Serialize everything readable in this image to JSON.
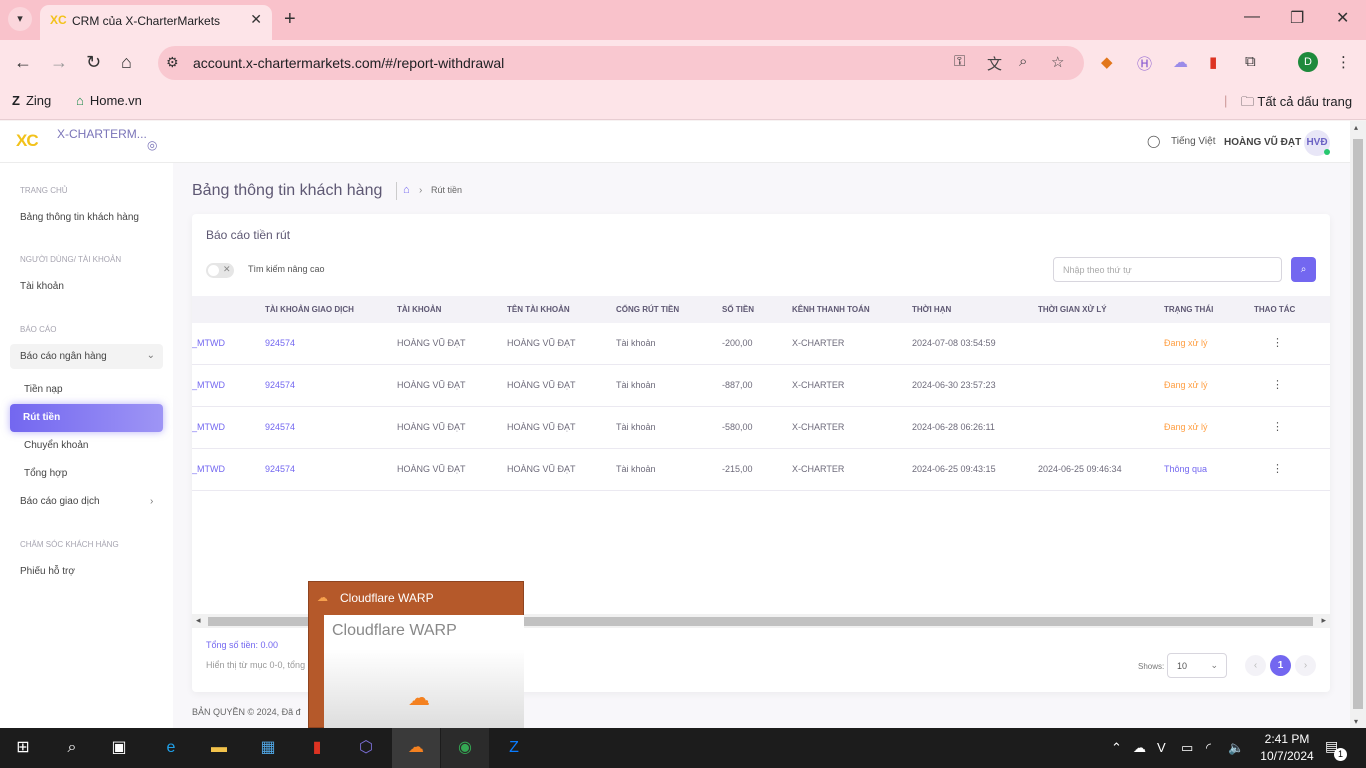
{
  "browser": {
    "tab_title": "CRM của X-CharterMarkets",
    "tab_logo": "XC",
    "url": "account.x-chartermarkets.com/#/report-withdrawal",
    "profile_letter": "D",
    "bookmarks": [
      {
        "label": "Zing",
        "icon": "Z"
      },
      {
        "label": "Home.vn",
        "icon": "⌂"
      }
    ],
    "all_bookmarks": "Tất cả dấu trang"
  },
  "header": {
    "logo_mark": "XC",
    "logo_text": "X-CHARTERM...",
    "language": "Tiếng Việt",
    "user_name": "HOÀNG VŨ ĐẠT",
    "avatar_initials": "HVĐ"
  },
  "sidebar": {
    "sec_home": "TRANG CHỦ",
    "dashboard": "Bảng thông tin khách hàng",
    "sec_users": "NGƯỜI DÙNG/ TÀI KHOẢN",
    "accounts": "Tài khoản",
    "sec_reports": "BÁO CÁO",
    "bank_reports": "Báo cáo ngân hàng",
    "deposit": "Tiền nạp",
    "withdraw": "Rút tiền",
    "transfer": "Chuyển khoản",
    "summary": "Tổng hợp",
    "trade_reports": "Báo cáo giao dịch",
    "sec_support": "CHĂM SÓC KHÁCH HÀNG",
    "tickets": "Phiếu hỗ trợ"
  },
  "page": {
    "title": "Bảng thông tin khách hàng",
    "breadcrumb_current": "Rút tiền",
    "card_title": "Báo cáo tiền rút",
    "advanced_search": "Tìm kiếm nâng cao",
    "search_placeholder": "Nhập theo thứ tự"
  },
  "table": {
    "headers": [
      "TÀI KHOẢN GIAO DỊCH",
      "TÀI KHOẢN",
      "TÊN TÀI KHOẢN",
      "CỔNG RÚT TIỀN",
      "SỐ TIỀN",
      "KÊNH THANH TOÁN",
      "THỜI HẠN",
      "THỜI GIAN XỬ LÝ",
      "TRẠNG THÁI",
      "THAO TÁC"
    ],
    "rows": [
      {
        "code": "_MTWD",
        "trade_acc": "924574",
        "account": "HOÀNG VŨ ĐẠT",
        "acc_name": "HOÀNG VŨ ĐẠT",
        "gateway": "Tài khoản",
        "amount": "-200,00",
        "channel": "X-CHARTER",
        "deadline": "2024-07-08 03:54:59",
        "processed": "",
        "status": "Đang xử lý",
        "status_type": "warn"
      },
      {
        "code": "_MTWD",
        "trade_acc": "924574",
        "account": "HOÀNG VŨ ĐẠT",
        "acc_name": "HOÀNG VŨ ĐẠT",
        "gateway": "Tài khoản",
        "amount": "-887,00",
        "channel": "X-CHARTER",
        "deadline": "2024-06-30 23:57:23",
        "processed": "",
        "status": "Đang xử lý",
        "status_type": "warn"
      },
      {
        "code": "_MTWD",
        "trade_acc": "924574",
        "account": "HOÀNG VŨ ĐẠT",
        "acc_name": "HOÀNG VŨ ĐẠT",
        "gateway": "Tài khoản",
        "amount": "-580,00",
        "channel": "X-CHARTER",
        "deadline": "2024-06-28 06:26:11",
        "processed": "",
        "status": "Đang xử lý",
        "status_type": "warn"
      },
      {
        "code": "_MTWD",
        "trade_acc": "924574",
        "account": "HOÀNG VŨ ĐẠT",
        "acc_name": "HOÀNG VŨ ĐẠT",
        "gateway": "Tài khoản",
        "amount": "-215,00",
        "channel": "X-CHARTER",
        "deadline": "2024-06-25 09:43:15",
        "processed": "2024-06-25 09:46:34",
        "status": "Thông qua",
        "status_type": "ok"
      }
    ]
  },
  "footer_info": {
    "total": "Tổng số tiền:  0.00",
    "showing": "Hiển thị từ mục 0-0, tổng",
    "shows_label": "Shows:",
    "page_size": "10",
    "current_page": "1",
    "copyright": "BẢN QUYỀN © 2024, Đã đ"
  },
  "warp": {
    "title": "Cloudflare WARP",
    "body_title": "Cloudflare WARP"
  },
  "taskbar": {
    "time": "2:41 PM",
    "date": "10/7/2024",
    "notifications": "1"
  }
}
